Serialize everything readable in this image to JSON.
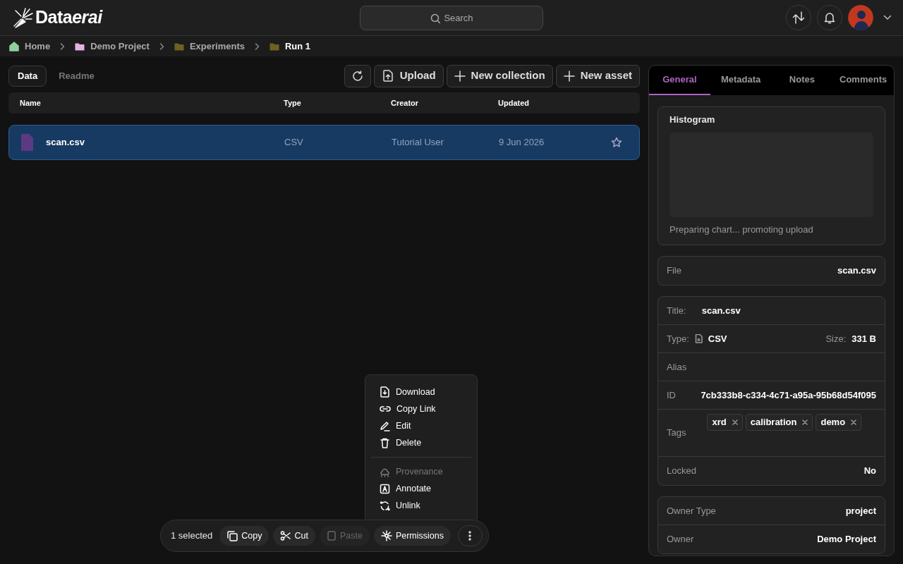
{
  "header": {
    "logo": "Data",
    "logo_accent": "erai",
    "search_placeholder": "Search"
  },
  "breadcrumb": [
    {
      "label": "Home",
      "kind": "home",
      "current": false
    },
    {
      "label": "Demo Project",
      "kind": "project",
      "current": false
    },
    {
      "label": "Experiments",
      "kind": "folder",
      "current": false
    },
    {
      "label": "Run 1",
      "kind": "folder",
      "current": true
    }
  ],
  "view_tabs": [
    {
      "label": "Data",
      "selected": true
    },
    {
      "label": "Readme",
      "selected": false
    }
  ],
  "toolbar": [
    {
      "kind": "refresh"
    },
    {
      "kind": "upload",
      "label": "Upload"
    },
    {
      "kind": "add",
      "label": "New collection"
    },
    {
      "kind": "add",
      "label": "New asset"
    }
  ],
  "table": {
    "columns": [
      "Name",
      "Type",
      "Creator",
      "Updated"
    ],
    "rows": [
      {
        "name": "scan.csv",
        "type": "CSV",
        "creator": "Tutorial User",
        "updated": "9 Jun 2026",
        "selected": true,
        "starred": false
      }
    ]
  },
  "panel": {
    "tabs": [
      {
        "label": "General",
        "selected": true
      },
      {
        "label": "Metadata",
        "selected": false
      },
      {
        "label": "Notes",
        "selected": false
      },
      {
        "label": "Comments",
        "selected": false
      }
    ],
    "histogram": {
      "title": "Histogram",
      "status": "Preparing chart... promoting upload"
    },
    "file": {
      "label": "File",
      "value": "scan.csv"
    },
    "details": {
      "title_label": "Title:",
      "title": "scan.csv",
      "type_label": "Type:",
      "type": "CSV",
      "size_label": "Size:",
      "size": "331 B",
      "alias_label": "Alias",
      "id_label": "ID",
      "id": "7cb333b8-c334-4c71-a95a-95b68d54f095",
      "tags_label": "Tags",
      "tags": [
        "xrd",
        "calibration",
        "demo"
      ],
      "locked_label": "Locked",
      "locked": "No"
    },
    "owner": [
      {
        "label": "Owner Type",
        "value": "project"
      },
      {
        "label": "Owner",
        "value": "Demo Project"
      }
    ]
  },
  "menu": [
    [
      {
        "label": "Download",
        "kind": "download",
        "disabled": false
      },
      {
        "label": "Copy Link",
        "kind": "link",
        "disabled": false
      },
      {
        "label": "Edit",
        "kind": "edit",
        "disabled": false
      },
      {
        "label": "Delete",
        "kind": "delete",
        "disabled": false
      }
    ],
    [
      {
        "label": "Provenance",
        "kind": "provenance",
        "disabled": true
      },
      {
        "label": "Annotate",
        "kind": "annotate",
        "disabled": false
      },
      {
        "label": "Unlink",
        "kind": "unlink",
        "disabled": false
      }
    ]
  ],
  "selection_bar": {
    "count": "1 selected",
    "actions": [
      {
        "label": "Copy",
        "kind": "copy",
        "disabled": false
      },
      {
        "label": "Cut",
        "kind": "cut",
        "disabled": false
      },
      {
        "label": "Paste",
        "kind": "paste",
        "disabled": true
      },
      {
        "label": "Permissions",
        "kind": "permissions",
        "disabled": false
      }
    ]
  }
}
